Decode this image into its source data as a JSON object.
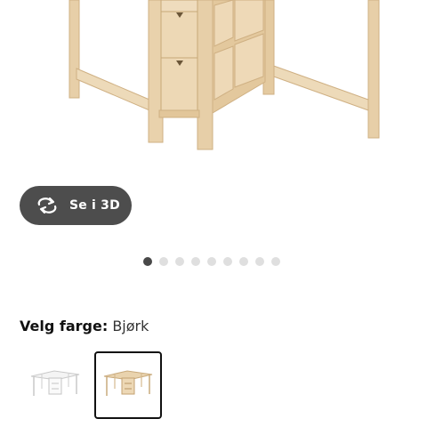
{
  "product": {
    "view_3d_label": "Se i 3D",
    "view_3d_icon": "rotate-arrows-icon",
    "image_alt": "folding-table-birch-with-drawers"
  },
  "carousel": {
    "total": 9,
    "active_index": 0
  },
  "color_picker": {
    "heading_prefix": "Velg farge:",
    "selected_color": "Bjørk",
    "swatches": [
      {
        "name": "white",
        "selected": false
      },
      {
        "name": "birch",
        "selected": true
      }
    ]
  },
  "colors": {
    "button_bg": "#4d4d4d",
    "dot_active": "#484848",
    "dot_inactive": "#dfdfdf",
    "wood": "#e9d3ae",
    "selected_border": "#111111"
  }
}
